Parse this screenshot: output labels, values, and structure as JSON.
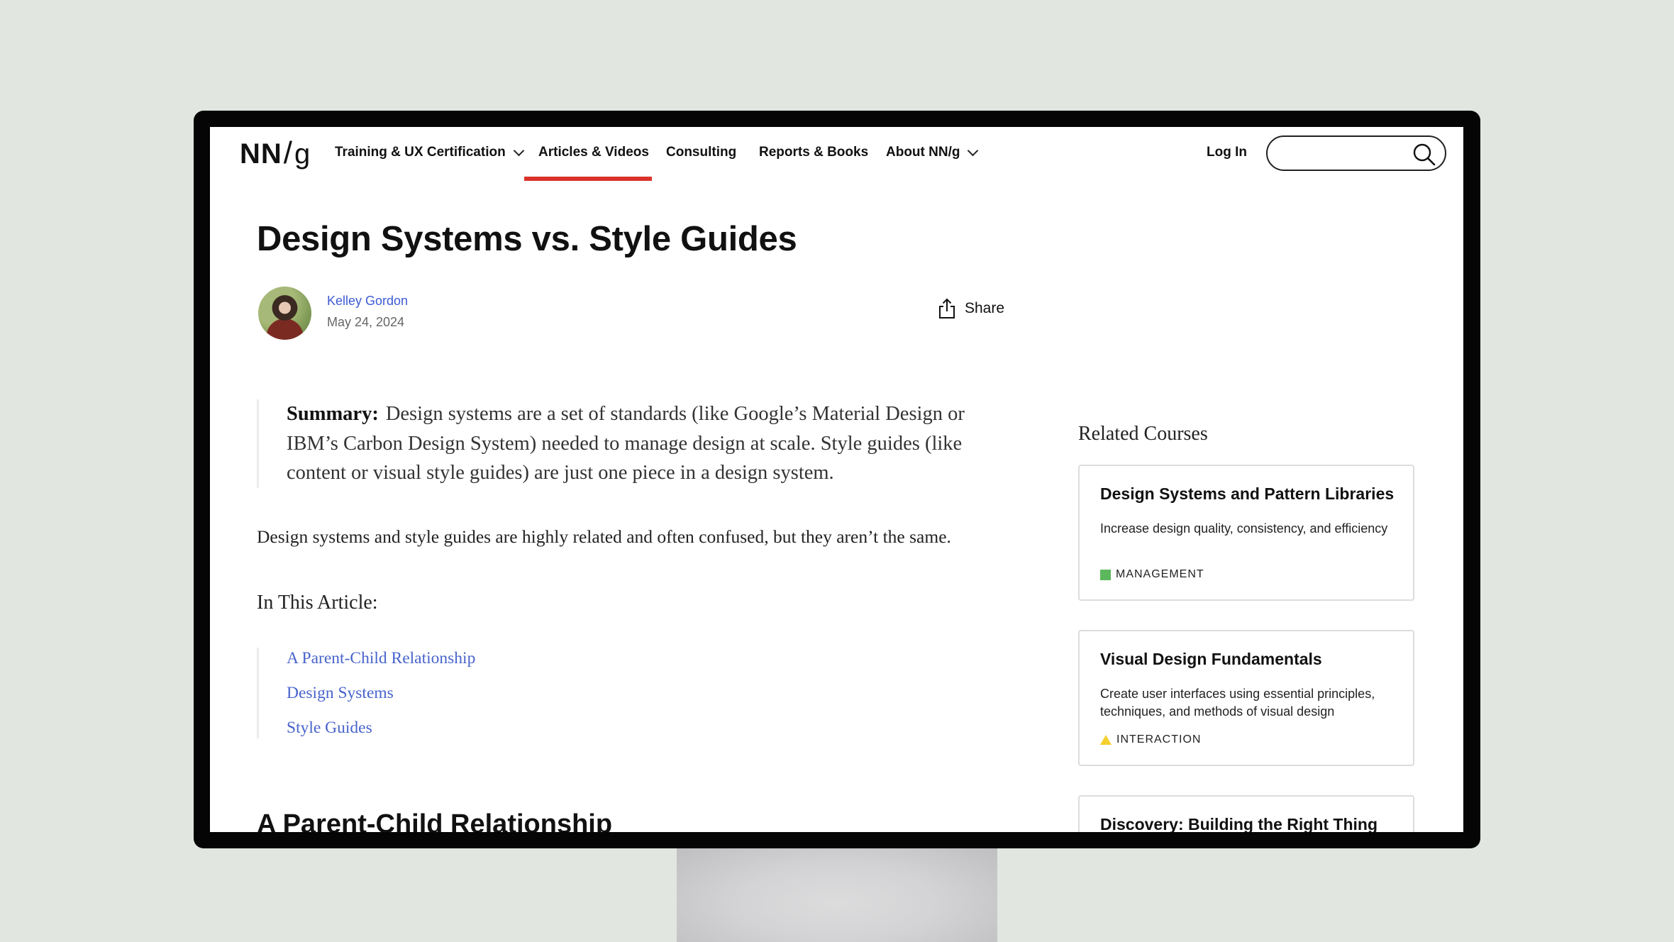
{
  "nav": {
    "logo": {
      "main": "NN",
      "slash": "/",
      "g": "g"
    },
    "items": [
      {
        "label": "Training & UX Certification",
        "has_dropdown": true
      },
      {
        "label": "Articles & Videos",
        "has_dropdown": false,
        "active": true
      },
      {
        "label": "Consulting",
        "has_dropdown": false
      },
      {
        "label": "Reports & Books",
        "has_dropdown": false
      },
      {
        "label": "About NN/g",
        "has_dropdown": true
      }
    ],
    "login_label": "Log In",
    "search": {
      "value": "",
      "placeholder": "",
      "icon": "search-icon"
    },
    "accent_color": "#d9332a"
  },
  "article": {
    "title": "Design Systems vs. Style Guides",
    "author": "Kelley Gordon",
    "date": "May 24, 2024",
    "share_label": "Share",
    "summary_label": "Summary:",
    "summary_text": "Design systems are a set of standards (like Google’s Material Design or IBM’s Carbon Design System) needed to manage design at scale. Style guides (like content or visual style guides) are just one piece in a design system.",
    "intro": "Design systems and style guides are highly related and often confused, but they aren’t the same.",
    "toc_title": "In This Article:",
    "toc": [
      "A Parent-Child Relationship",
      "Design Systems",
      "Style Guides"
    ],
    "section_heading": "A Parent-Child Relationship",
    "link_color": "#4864cc"
  },
  "sidebar": {
    "title": "Related Courses",
    "courses": [
      {
        "title": "Design Systems and Pattern Libraries",
        "description": "Increase design quality, consistency, and efficiency",
        "category": "MANAGEMENT",
        "category_icon": "green-square",
        "color": "#5cb85c"
      },
      {
        "title": "Visual Design Fundamentals",
        "description": "Create user interfaces using essential principles, techniques, and methods of visual design",
        "category": "INTERACTION",
        "category_icon": "yellow-triangle",
        "color": "#f5cf2e"
      },
      {
        "title": "Discovery: Building the Right Thing",
        "description": "",
        "category": ""
      }
    ]
  }
}
